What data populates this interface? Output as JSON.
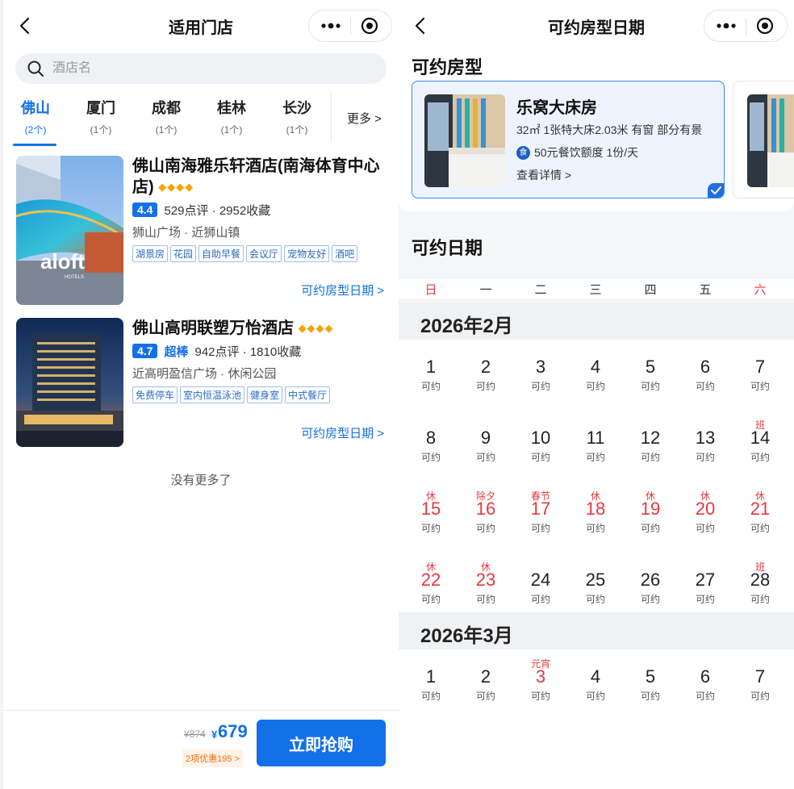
{
  "left": {
    "nav": {
      "title": "适用门店"
    },
    "search": {
      "placeholder": "酒店名"
    },
    "tabs": [
      {
        "name": "佛山",
        "count": "(2个)",
        "active": true
      },
      {
        "name": "厦门",
        "count": "(1个)"
      },
      {
        "name": "成都",
        "count": "(1个)"
      },
      {
        "name": "桂林",
        "count": "(1个)"
      },
      {
        "name": "长沙",
        "count": "(1个)"
      }
    ],
    "tabs_more": "更多 >",
    "hotels": [
      {
        "name": "佛山南海雅乐轩酒店(南海体育中心店)",
        "diamonds": "◆◆◆◆",
        "score": "4.4",
        "score_word": "",
        "stats": "529点评 · 2952收藏",
        "location": "狮山广场 · 近狮山镇",
        "tags": [
          "湖景房",
          "花园",
          "自助早餐",
          "会议厅",
          "宠物友好",
          "酒吧"
        ],
        "link": "可约房型日期 >"
      },
      {
        "name": "佛山高明联塑万怡酒店",
        "diamonds": "◆◆◆◆",
        "score": "4.7",
        "score_word": "超棒",
        "stats": "942点评 · 1810收藏",
        "location": "近高明盈信广场 · 休闲公园",
        "tags": [
          "免费停车",
          "室内恒温泳池",
          "健身室",
          "中式餐厅"
        ],
        "link": "可约房型日期 >"
      }
    ],
    "no_more": "没有更多了",
    "footer": {
      "original_price": "¥874",
      "currency": "¥",
      "price": "679",
      "promo": "2项优惠195 >",
      "buy_label": "立即抢购"
    }
  },
  "right": {
    "nav": {
      "title": "可约房型日期"
    },
    "room_section_title": "可约房型",
    "room": {
      "name": "乐窝大床房",
      "desc": "32㎡ 1张特大床2.03米 有窗 部分有景",
      "perk_icon": "食",
      "perk": "50元餐饮额度 1份/天",
      "detail": "查看详情 >"
    },
    "dates_section_title": "可约日期",
    "weekdays": [
      "日",
      "一",
      "二",
      "三",
      "四",
      "五",
      "六"
    ],
    "months": [
      {
        "title": "2026年2月",
        "days": [
          {
            "d": "1",
            "col": 0,
            "row": 0,
            "avail": "可约"
          },
          {
            "d": "2",
            "col": 1,
            "row": 0,
            "avail": "可约"
          },
          {
            "d": "3",
            "col": 2,
            "row": 0,
            "avail": "可约"
          },
          {
            "d": "4",
            "col": 3,
            "row": 0,
            "avail": "可约"
          },
          {
            "d": "5",
            "col": 4,
            "row": 0,
            "avail": "可约"
          },
          {
            "d": "6",
            "col": 5,
            "row": 0,
            "avail": "可约"
          },
          {
            "d": "7",
            "col": 6,
            "row": 0,
            "avail": "可约"
          },
          {
            "d": "8",
            "col": 0,
            "row": 1,
            "avail": "可约"
          },
          {
            "d": "9",
            "col": 1,
            "row": 1,
            "avail": "可约"
          },
          {
            "d": "10",
            "col": 2,
            "row": 1,
            "avail": "可约"
          },
          {
            "d": "11",
            "col": 3,
            "row": 1,
            "avail": "可约"
          },
          {
            "d": "12",
            "col": 4,
            "row": 1,
            "avail": "可约"
          },
          {
            "d": "13",
            "col": 5,
            "row": 1,
            "avail": "可约"
          },
          {
            "d": "14",
            "col": 6,
            "row": 1,
            "avail": "可约",
            "label": "班",
            "work": true
          },
          {
            "d": "15",
            "col": 0,
            "row": 2,
            "avail": "可约",
            "label": "休",
            "red": true
          },
          {
            "d": "16",
            "col": 1,
            "row": 2,
            "avail": "可约",
            "label": "除夕",
            "red": true
          },
          {
            "d": "17",
            "col": 2,
            "row": 2,
            "avail": "可约",
            "label": "春节",
            "red": true
          },
          {
            "d": "18",
            "col": 3,
            "row": 2,
            "avail": "可约",
            "label": "休",
            "red": true
          },
          {
            "d": "19",
            "col": 4,
            "row": 2,
            "avail": "可约",
            "label": "休",
            "red": true
          },
          {
            "d": "20",
            "col": 5,
            "row": 2,
            "avail": "可约",
            "label": "休",
            "red": true
          },
          {
            "d": "21",
            "col": 6,
            "row": 2,
            "avail": "可约",
            "label": "休",
            "red": true
          },
          {
            "d": "22",
            "col": 0,
            "row": 3,
            "avail": "可约",
            "label": "休",
            "red": true
          },
          {
            "d": "23",
            "col": 1,
            "row": 3,
            "avail": "可约",
            "label": "休",
            "red": true
          },
          {
            "d": "24",
            "col": 2,
            "row": 3,
            "avail": "可约"
          },
          {
            "d": "25",
            "col": 3,
            "row": 3,
            "avail": "可约"
          },
          {
            "d": "26",
            "col": 4,
            "row": 3,
            "avail": "可约"
          },
          {
            "d": "27",
            "col": 5,
            "row": 3,
            "avail": "可约"
          },
          {
            "d": "28",
            "col": 6,
            "row": 3,
            "avail": "可约",
            "label": "班",
            "work": true
          }
        ]
      },
      {
        "title": "2026年3月",
        "days": [
          {
            "d": "1",
            "col": 0,
            "row": 0,
            "avail": "可约"
          },
          {
            "d": "2",
            "col": 1,
            "row": 0,
            "avail": "可约"
          },
          {
            "d": "3",
            "col": 2,
            "row": 0,
            "avail": "可约",
            "label": "元宵",
            "red": true
          },
          {
            "d": "4",
            "col": 3,
            "row": 0,
            "avail": "可约"
          },
          {
            "d": "5",
            "col": 4,
            "row": 0,
            "avail": "可约"
          },
          {
            "d": "6",
            "col": 5,
            "row": 0,
            "avail": "可约"
          },
          {
            "d": "7",
            "col": 6,
            "row": 0,
            "avail": "可约"
          }
        ]
      }
    ]
  },
  "colors": {
    "accent": "#1270e8",
    "holiday": "#e8383d",
    "diamond": "#f5a400",
    "promo": "#ff6a00"
  }
}
